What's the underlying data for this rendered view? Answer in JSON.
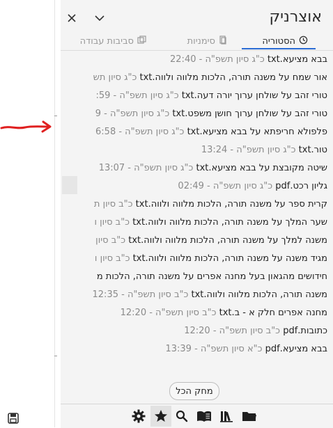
{
  "panel": {
    "title": "אוצרניק",
    "close_icon": "close-icon",
    "collapse_icon": "chevron-down-icon"
  },
  "tabs": [
    {
      "label": "הסטוריה",
      "icon": "history-icon",
      "active": true
    },
    {
      "label": "סימניות",
      "icon": "bookmarks-icon",
      "active": false
    },
    {
      "label": "סביבות עבודה",
      "icon": "workspaces-icon",
      "active": false
    }
  ],
  "history": [
    {
      "name": "בבא מציעא.txt",
      "date": "כ\"ג סיון תשפ\"ה - 22:40"
    },
    {
      "name": "אור שמח על משנה תורה, הלכות מלווה ולווה.txt",
      "date": "כ\"ג סיון תש"
    },
    {
      "name": "טורי זהב על שולחן ערוך יורה דעה.txt",
      "date": "כ\"ג סיון תשפ\"ה - 59:"
    },
    {
      "name": "טורי זהב על שולחן ערוך חושן משפט.txt",
      "date": "כ\"ג סיון תשפ\"ה - 9"
    },
    {
      "name": "פלפולא חריפתא על בבא מציעא.txt",
      "date": "כ\"ג סיון תשפ\"ה - 6:58"
    },
    {
      "name": "טור.txt",
      "date": "כ\"ג סיון תשפ\"ה - 13:24"
    },
    {
      "name": "שיטה מקובצת על בבא מציעא.txt",
      "date": "כ\"ג סיון תשפ\"ה - 13:07"
    },
    {
      "name": "גליון רכט.pdf",
      "date": "כ\"ג סיון תשפ\"ה - 02:49"
    },
    {
      "name": "קרית ספר על משנה תורה, הלכות מלווה ולווה.txt",
      "date": "כ\"ב סיון ת"
    },
    {
      "name": "שער המלך על משנה תורה, הלכות מלווה ולווה.txt",
      "date": "כ\"ב סיון ו"
    },
    {
      "name": "משנה למלך על משנה תורה, הלכות מלווה ולווה.txt",
      "date": "כ\"ב סיון"
    },
    {
      "name": "מגיד משנה על משנה תורה, הלכות מלווה ולווה.txt",
      "date": "כ\"ב סיון ו"
    },
    {
      "name": "חידושים מהגאון בעל מחנה אפרים על משנה תורה, הלכות מ",
      "date": ""
    },
    {
      "name": "משנה תורה, הלכות מלווה ולווה.txt",
      "date": "כ\"ב סיון תשפ\"ה - 12:35"
    },
    {
      "name": "מחנה אפרים חלק א - ב.txt",
      "date": "כ\"ב סיון תשפ\"ה - 12:20"
    },
    {
      "name": "כתובות.pdf",
      "date": "כ\"ב סיון תשפ\"ה - 12:20"
    },
    {
      "name": "בבא מציעא.pdf",
      "date": "כ\"א סיון תשפ\"ה - 13:39"
    }
  ],
  "clear_button": "מחק הכל",
  "bottom_bar": {
    "icons": [
      "folder-icon",
      "library-icon",
      "book-icon",
      "search-icon",
      "star-icon",
      "gear-icon"
    ],
    "active": "star-icon",
    "left_icon": "save-icon"
  },
  "colors": {
    "accent": "#2b6cd4",
    "arrow": "#e02020",
    "panel_bg": "#f4f4f4"
  }
}
